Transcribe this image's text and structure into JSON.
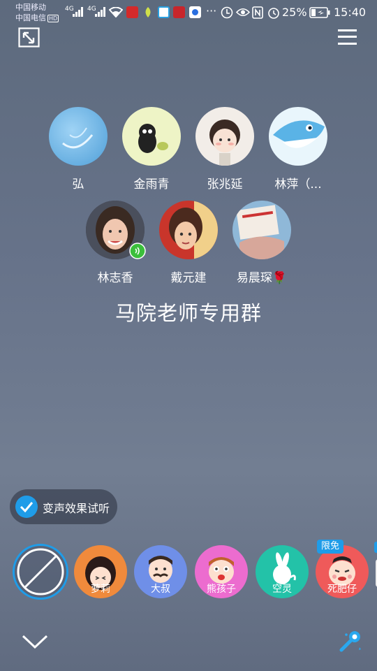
{
  "status_bar": {
    "carrier_1": "中国移动",
    "carrier_2": "中国电信",
    "hd_badge": "HD",
    "net_1": "4G",
    "net_2": "4G",
    "more": "···",
    "battery": "25%",
    "time": "15:40"
  },
  "toolbar": {
    "minimize_icon": "shrink-arrows-icon",
    "menu_icon": "hamburger-menu-icon"
  },
  "members": [
    {
      "name": "弘"
    },
    {
      "name": "金雨青"
    },
    {
      "name": "张兆延"
    },
    {
      "name": "林萍（..."
    },
    {
      "name": "林志香"
    },
    {
      "name": "戴元建"
    },
    {
      "name": "易晨琛🌹"
    }
  ],
  "group_title": "马院老师专用群",
  "voice_toggle": {
    "label": "变声效果试听",
    "checked": true
  },
  "effects": [
    {
      "label": ""
    },
    {
      "label": "萝莉"
    },
    {
      "label": "大叔"
    },
    {
      "label": "熊孩子"
    },
    {
      "label": "空灵"
    },
    {
      "label": "死肥仔"
    }
  ],
  "free_badge": "限免",
  "bottom": {
    "collapse_icon": "chevron-down-icon",
    "voice_change_icon": "voice-change-wand-icon"
  },
  "colors": {
    "accent": "#1f9ce8",
    "speaking": "#3bbf3b"
  }
}
